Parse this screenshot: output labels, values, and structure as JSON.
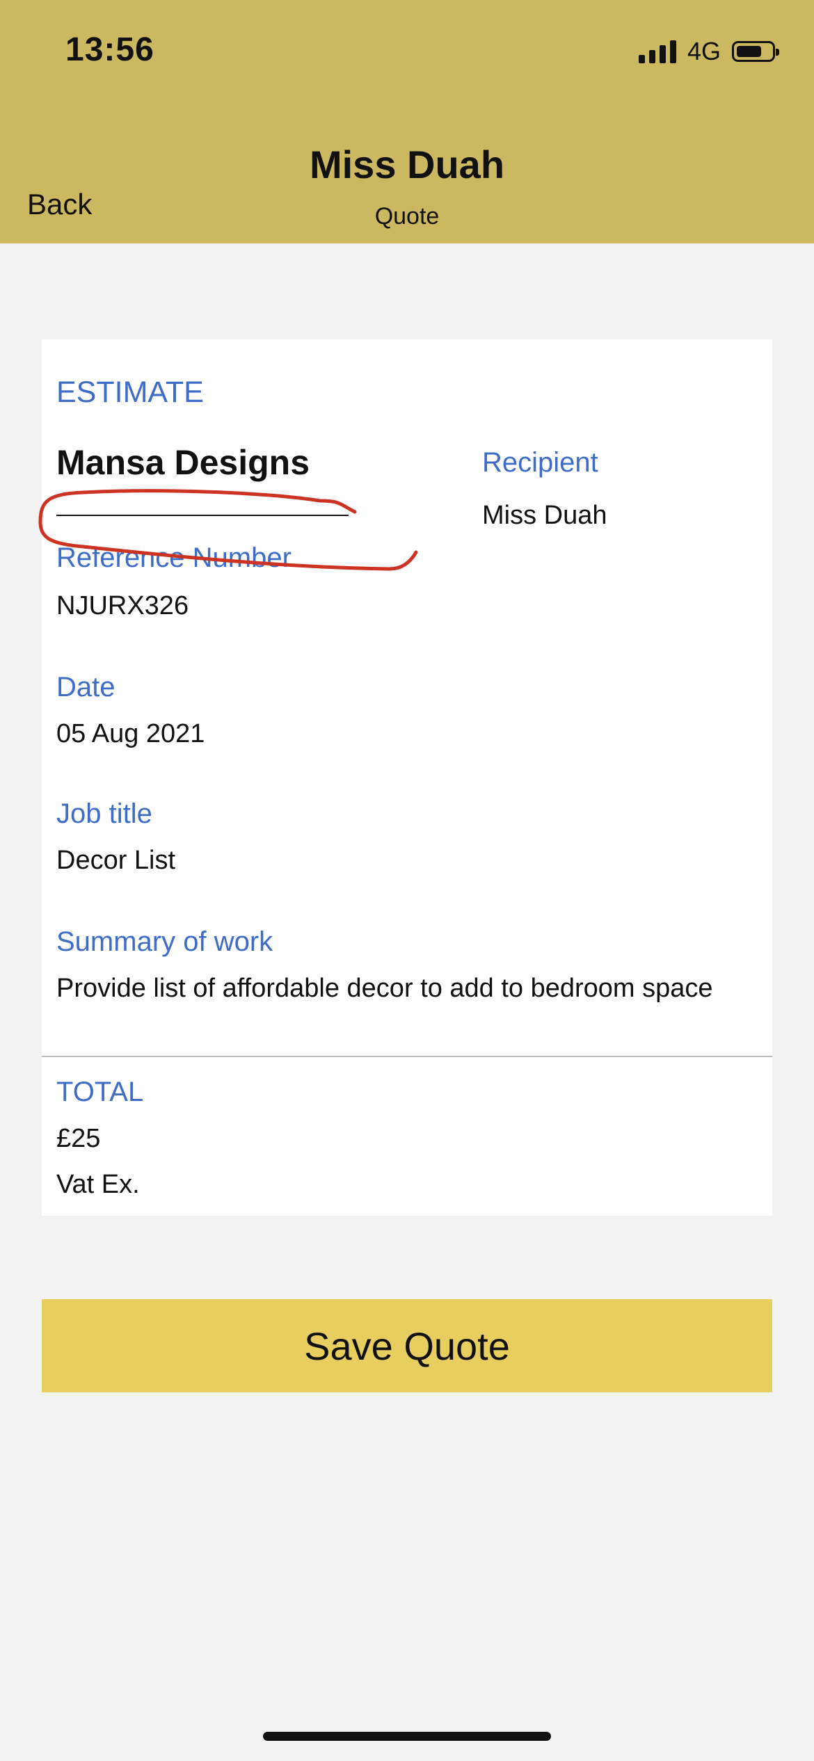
{
  "status_bar": {
    "time": "13:56",
    "network": "4G",
    "battery_level": 0.75
  },
  "nav": {
    "title": "Miss Duah",
    "subtitle": "Quote",
    "back_label": "Back"
  },
  "card": {
    "heading": "ESTIMATE",
    "company": "Mansa Designs",
    "recipient_label": "Recipient",
    "recipient_value": "Miss Duah",
    "reference_label": "Reference Number",
    "reference_value": "NJURX326",
    "date_label": "Date",
    "date_value": "05 Aug 2021",
    "job_title_label": "Job title",
    "job_title_value": "Decor List",
    "summary_label": "Summary of work",
    "summary_value": "Provide list of affordable decor to add to bedroom space",
    "total_label": "TOTAL",
    "total_value": "£25",
    "vat_note": "Vat Ex."
  },
  "actions": {
    "save_label": "Save Quote"
  },
  "colors": {
    "header": "#cbb861",
    "accent_label": "#3e6cc7",
    "button": "#e7ce5e",
    "annotation": "#cc3322"
  }
}
